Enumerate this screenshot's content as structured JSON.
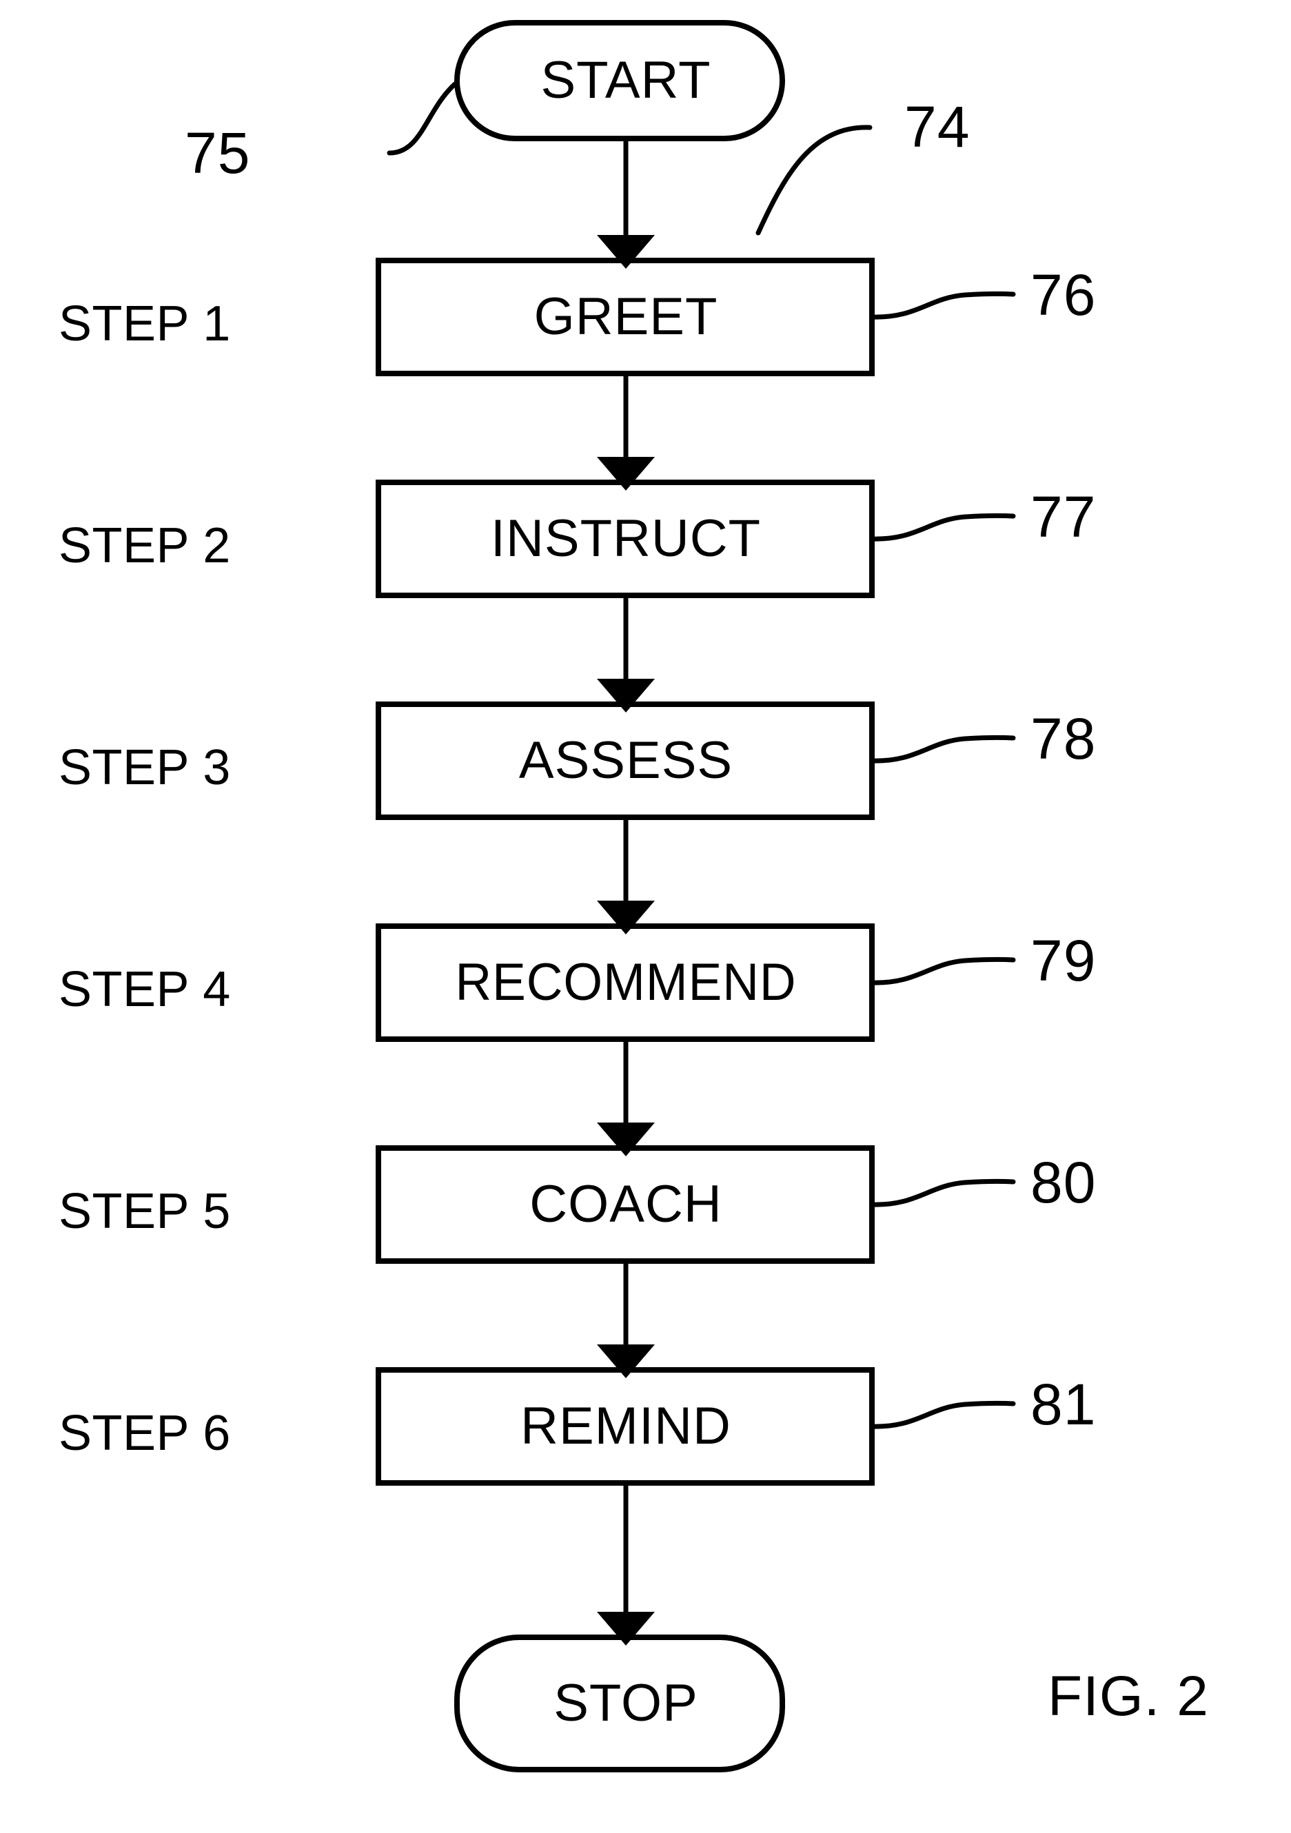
{
  "figure": {
    "caption": "FIG. 2",
    "background_color": "#ffffff",
    "line_color": "#000000"
  },
  "flow": {
    "start_terminal": {
      "label": "START",
      "shape": "rounded-terminal",
      "reference_number": "75"
    },
    "stop_terminal": {
      "label": "STOP",
      "shape": "rounded-terminal"
    },
    "process_reference_number": "74",
    "steps": [
      {
        "step_label": "STEP 1",
        "box_label": "GREET",
        "reference_number": "76"
      },
      {
        "step_label": "STEP 2",
        "box_label": "INSTRUCT",
        "reference_number": "77"
      },
      {
        "step_label": "STEP 3",
        "box_label": "ASSESS",
        "reference_number": "78"
      },
      {
        "step_label": "STEP 4",
        "box_label": "RECOMMEND",
        "reference_number": "79"
      },
      {
        "step_label": "STEP 5",
        "box_label": "COACH",
        "reference_number": "80"
      },
      {
        "step_label": "STEP 6",
        "box_label": "REMIND",
        "reference_number": "81"
      }
    ]
  },
  "chart_data": {
    "type": "diagram",
    "diagram_kind": "flowchart",
    "orientation": "vertical",
    "title": "FIG. 2",
    "nodes": [
      {
        "id": "start",
        "text": "START",
        "shape": "terminator",
        "reference": "75"
      },
      {
        "id": "s1",
        "text": "GREET",
        "shape": "process",
        "reference": "76",
        "step": "STEP 1"
      },
      {
        "id": "s2",
        "text": "INSTRUCT",
        "shape": "process",
        "reference": "77",
        "step": "STEP 2"
      },
      {
        "id": "s3",
        "text": "ASSESS",
        "shape": "process",
        "reference": "78",
        "step": "STEP 3"
      },
      {
        "id": "s4",
        "text": "RECOMMEND",
        "shape": "process",
        "reference": "79",
        "step": "STEP 4"
      },
      {
        "id": "s5",
        "text": "COACH",
        "shape": "process",
        "reference": "80",
        "step": "STEP 5"
      },
      {
        "id": "s6",
        "text": "REMIND",
        "shape": "process",
        "reference": "81",
        "step": "STEP 6"
      },
      {
        "id": "stop",
        "text": "STOP",
        "shape": "terminator"
      }
    ],
    "edges": [
      {
        "from": "start",
        "to": "s1",
        "arrow": true
      },
      {
        "from": "s1",
        "to": "s2",
        "arrow": true
      },
      {
        "from": "s2",
        "to": "s3",
        "arrow": true
      },
      {
        "from": "s3",
        "to": "s4",
        "arrow": true
      },
      {
        "from": "s4",
        "to": "s5",
        "arrow": true
      },
      {
        "from": "s5",
        "to": "s6",
        "arrow": true
      },
      {
        "from": "s6",
        "to": "stop",
        "arrow": true
      }
    ],
    "annotations": [
      {
        "text": "74",
        "points_to": "process-flow"
      },
      {
        "text": "75",
        "points_to": "start"
      },
      {
        "text": "76",
        "points_to": "s1"
      },
      {
        "text": "77",
        "points_to": "s2"
      },
      {
        "text": "78",
        "points_to": "s3"
      },
      {
        "text": "79",
        "points_to": "s4"
      },
      {
        "text": "80",
        "points_to": "s5"
      },
      {
        "text": "81",
        "points_to": "s6"
      }
    ]
  }
}
